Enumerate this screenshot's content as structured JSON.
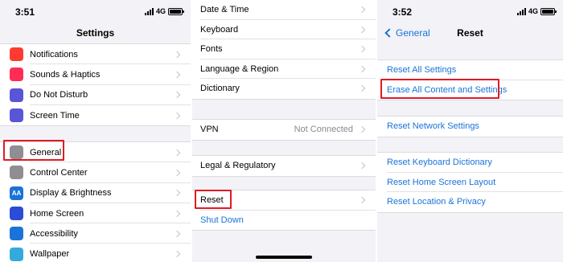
{
  "left": {
    "status": {
      "time": "3:51",
      "network": "4G"
    },
    "title": "Settings",
    "group1": [
      {
        "label": "Notifications",
        "icon": "notifications-icon",
        "color": "#ff3b30"
      },
      {
        "label": "Sounds & Haptics",
        "icon": "sound-icon",
        "color": "#ff2d55"
      },
      {
        "label": "Do Not Disturb",
        "icon": "moon-icon",
        "color": "#5856d6"
      },
      {
        "label": "Screen Time",
        "icon": "hourglass-icon",
        "color": "#5856d6"
      }
    ],
    "group2": [
      {
        "label": "General",
        "icon": "gear-icon",
        "color": "#8e8e93"
      },
      {
        "label": "Control Center",
        "icon": "toggles-icon",
        "color": "#8e8e93"
      },
      {
        "label": "Display & Brightness",
        "icon": "text-size-icon",
        "color": "#1a73d9",
        "glyph": "AA"
      },
      {
        "label": "Home Screen",
        "icon": "grid-icon",
        "color": "#2c4bd6"
      },
      {
        "label": "Accessibility",
        "icon": "accessibility-icon",
        "color": "#1a73d9"
      },
      {
        "label": "Wallpaper",
        "icon": "flower-icon",
        "color": "#34aadc"
      }
    ]
  },
  "middle": {
    "group1": [
      "Date & Time",
      "Keyboard",
      "Fonts",
      "Language & Region",
      "Dictionary"
    ],
    "vpn": {
      "label": "VPN",
      "value": "Not Connected"
    },
    "legal": "Legal & Regulatory",
    "reset": "Reset",
    "shutdown": "Shut Down"
  },
  "right": {
    "status": {
      "time": "3:52",
      "network": "4G"
    },
    "back": "General",
    "title": "Reset",
    "group1": [
      "Reset All Settings",
      "Erase All Content and Settings"
    ],
    "group2": [
      "Reset Network Settings"
    ],
    "group3": [
      "Reset Keyboard Dictionary",
      "Reset Home Screen Layout",
      "Reset Location & Privacy"
    ]
  },
  "colors": {
    "accent": "#1a73d9",
    "highlight": "#e01b24"
  }
}
